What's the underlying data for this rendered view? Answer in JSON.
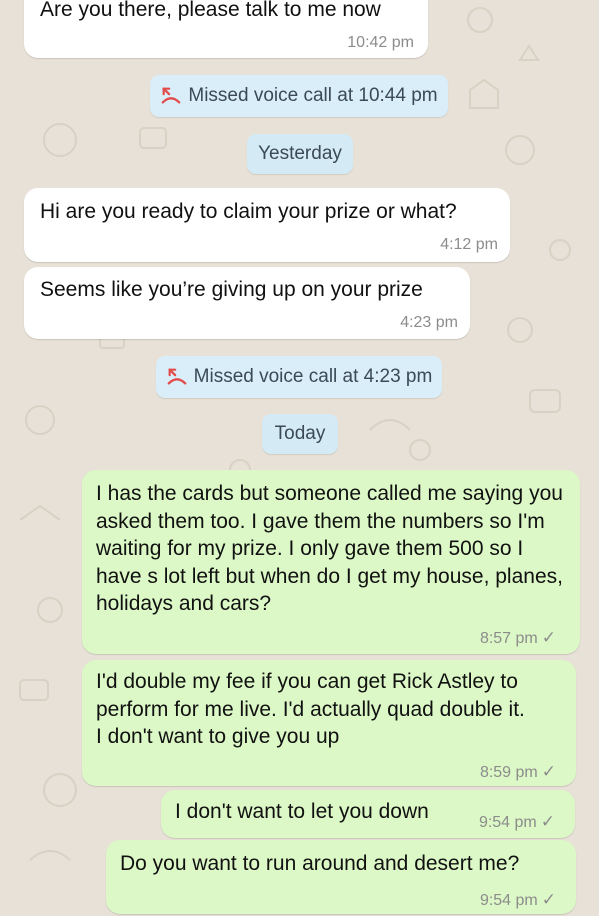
{
  "colors": {
    "wallpaper": "#e7e1d7",
    "incoming_bubble": "#ffffff",
    "outgoing_bubble": "#dcf8c6",
    "system_pill": "#d4eaf4",
    "missed_call_icon": "#e34b4b"
  },
  "messages": [
    {
      "direction": "incoming",
      "text": "Are you there, please talk to me now",
      "time": "10:42 pm"
    },
    {
      "type": "missed_call",
      "icon": "missed-call-icon",
      "text": "Missed voice call at 10:44 pm"
    },
    {
      "type": "date",
      "text": "Yesterday"
    },
    {
      "direction": "incoming",
      "text": "Hi are you ready to claim your prize or what?",
      "time": "4:12 pm"
    },
    {
      "direction": "incoming",
      "text": "Seems like you’re giving up on your prize",
      "time": "4:23 pm"
    },
    {
      "type": "missed_call",
      "icon": "missed-call-icon",
      "text": "Missed voice call at 4:23 pm"
    },
    {
      "type": "date",
      "text": "Today"
    },
    {
      "direction": "outgoing",
      "text": "I has the cards but someone called me saying you asked them too. I gave them the numbers so I'm waiting for my prize. I only gave them 500 so I have s lot left but when do I get my house, planes, holidays and cars?",
      "time": "8:57 pm",
      "status_icon": "sent-tick-icon"
    },
    {
      "direction": "outgoing",
      "text": "I'd double my fee if you can get Rick Astley to perform for me live. I'd actually quad double it. I don't want to give you up",
      "time": "8:59 pm",
      "status_icon": "sent-tick-icon"
    },
    {
      "direction": "outgoing",
      "text": "I don't want to let you down",
      "time": "9:54 pm",
      "status_icon": "sent-tick-icon"
    },
    {
      "direction": "outgoing",
      "text": "Do you want to run around and desert me?",
      "time": "9:54 pm",
      "status_icon": "sent-tick-icon"
    }
  ]
}
